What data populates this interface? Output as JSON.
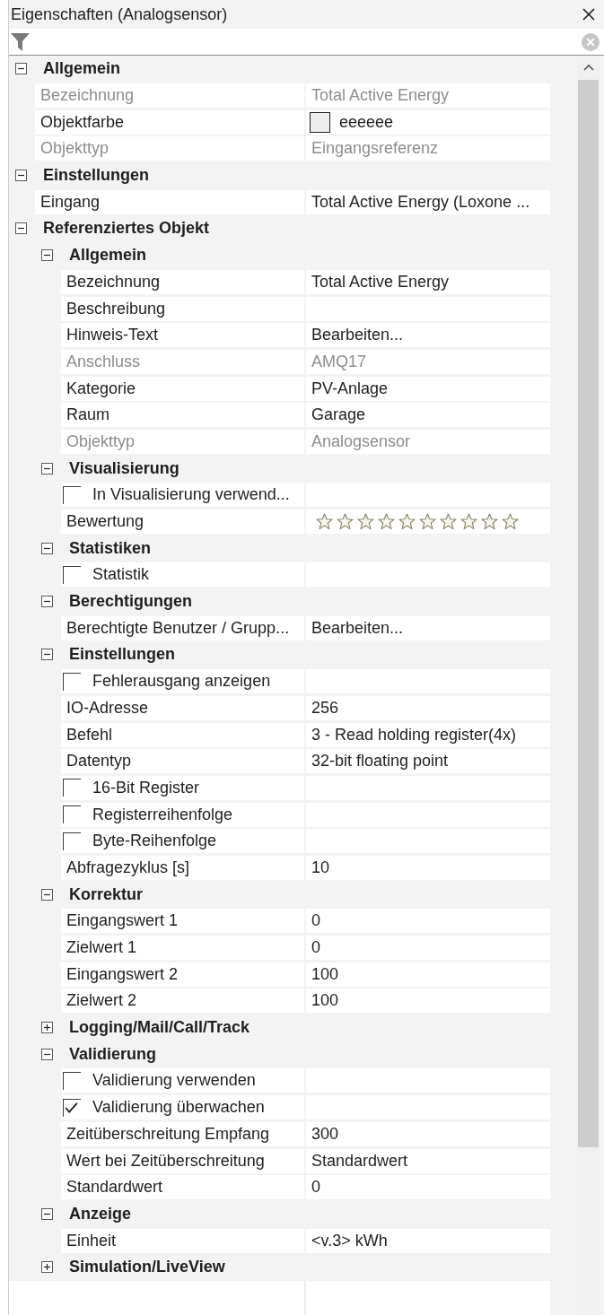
{
  "panel": {
    "title": "Eigenschaften (Analogsensor)"
  },
  "categories": [
    {
      "kind": "category",
      "label": "Allgemein",
      "expanded": true,
      "children": [
        {
          "kind": "property",
          "label": "Bezeichnung",
          "value": "Total Active Energy",
          "disabled": true
        },
        {
          "kind": "color",
          "label": "Objektfarbe",
          "value": "eeeeee",
          "color": "#eeeeee",
          "disabled": false
        },
        {
          "kind": "property",
          "label": "Objekttyp",
          "value": "Eingangsreferenz",
          "disabled": true
        }
      ]
    },
    {
      "kind": "category",
      "label": "Einstellungen",
      "expanded": true,
      "children": [
        {
          "kind": "property",
          "label": "Eingang",
          "value": "Total Active Energy (Loxone ...",
          "disabled": false
        }
      ]
    },
    {
      "kind": "category",
      "label": "Referenziertes Objekt",
      "expanded": true,
      "children": [
        {
          "kind": "category",
          "label": "Allgemein",
          "expanded": true,
          "children": [
            {
              "kind": "property",
              "label": "Bezeichnung",
              "value": "Total Active Energy",
              "disabled": false
            },
            {
              "kind": "property",
              "label": "Beschreibung",
              "disabled": false
            },
            {
              "kind": "property",
              "label": "Hinweis-Text",
              "value": "Bearbeiten...",
              "disabled": false
            },
            {
              "kind": "property",
              "label": "Anschluss",
              "value": "AMQ17",
              "disabled": true
            },
            {
              "kind": "property",
              "label": "Kategorie",
              "value": "PV-Anlage",
              "disabled": false
            },
            {
              "kind": "property",
              "label": "Raum",
              "value": "Garage",
              "disabled": false
            },
            {
              "kind": "property",
              "label": "Objekttyp",
              "value": "Analogsensor",
              "disabled": true
            }
          ]
        },
        {
          "kind": "category",
          "label": "Visualisierung",
          "expanded": true,
          "children": [
            {
              "kind": "checkbox",
              "label": "In Visualisierung verwend...",
              "checked": false,
              "disabled": false
            },
            {
              "kind": "rating",
              "label": "Bewertung",
              "stars": 0,
              "disabled": false
            }
          ]
        },
        {
          "kind": "category",
          "label": "Statistiken",
          "expanded": true,
          "children": [
            {
              "kind": "checkbox",
              "label": "Statistik",
              "checked": false,
              "disabled": false
            }
          ]
        },
        {
          "kind": "category",
          "label": "Berechtigungen",
          "expanded": true,
          "children": [
            {
              "kind": "property",
              "label": "Berechtigte Benutzer / Grupp...",
              "value": "Bearbeiten...",
              "disabled": false
            }
          ]
        },
        {
          "kind": "category",
          "label": "Einstellungen",
          "expanded": true,
          "children": [
            {
              "kind": "checkbox",
              "label": "Fehlerausgang anzeigen",
              "checked": false,
              "disabled": false
            },
            {
              "kind": "property",
              "label": "IO-Adresse",
              "value": "256",
              "disabled": false
            },
            {
              "kind": "property",
              "label": "Befehl",
              "value": "3 - Read holding register(4x)",
              "disabled": false
            },
            {
              "kind": "property",
              "label": "Datentyp",
              "value": "32-bit floating point",
              "disabled": false
            },
            {
              "kind": "checkbox",
              "label": "16-Bit Register",
              "checked": false,
              "disabled": false
            },
            {
              "kind": "checkbox",
              "label": "Registerreihenfolge",
              "checked": false,
              "disabled": false
            },
            {
              "kind": "checkbox",
              "label": "Byte-Reihenfolge",
              "checked": false,
              "disabled": false
            },
            {
              "kind": "property",
              "label": "Abfragezyklus [s]",
              "value": "10",
              "disabled": false
            }
          ]
        },
        {
          "kind": "category",
          "label": "Korrektur",
          "expanded": true,
          "children": [
            {
              "kind": "property",
              "label": "Eingangswert 1",
              "value": "0",
              "disabled": false
            },
            {
              "kind": "property",
              "label": "Zielwert 1",
              "value": "0",
              "disabled": false
            },
            {
              "kind": "property",
              "label": "Eingangswert 2",
              "value": "100",
              "disabled": false
            },
            {
              "kind": "property",
              "label": "Zielwert 2",
              "value": "100",
              "disabled": false
            }
          ]
        },
        {
          "kind": "category",
          "label": "Logging/Mail/Call/Track",
          "expanded": false
        },
        {
          "kind": "category",
          "label": "Validierung",
          "expanded": true,
          "children": [
            {
              "kind": "checkbox",
              "label": "Validierung verwenden",
              "checked": false,
              "disabled": false
            },
            {
              "kind": "checkbox",
              "label": "Validierung überwachen",
              "checked": true,
              "disabled": false
            },
            {
              "kind": "property",
              "label": "Zeitüberschreitung Empfang",
              "value": "300",
              "disabled": false
            },
            {
              "kind": "property",
              "label": "Wert bei Zeitüberschreitung",
              "value": "Standardwert",
              "disabled": false
            },
            {
              "kind": "property",
              "label": "Standardwert",
              "value": "0",
              "disabled": false
            }
          ]
        },
        {
          "kind": "category",
          "label": "Anzeige",
          "expanded": true,
          "children": [
            {
              "kind": "property",
              "label": "Einheit",
              "value": "<v.3> kWh",
              "disabled": false
            }
          ]
        },
        {
          "kind": "category",
          "label": "Simulation/LiveView",
          "expanded": false
        }
      ]
    }
  ]
}
